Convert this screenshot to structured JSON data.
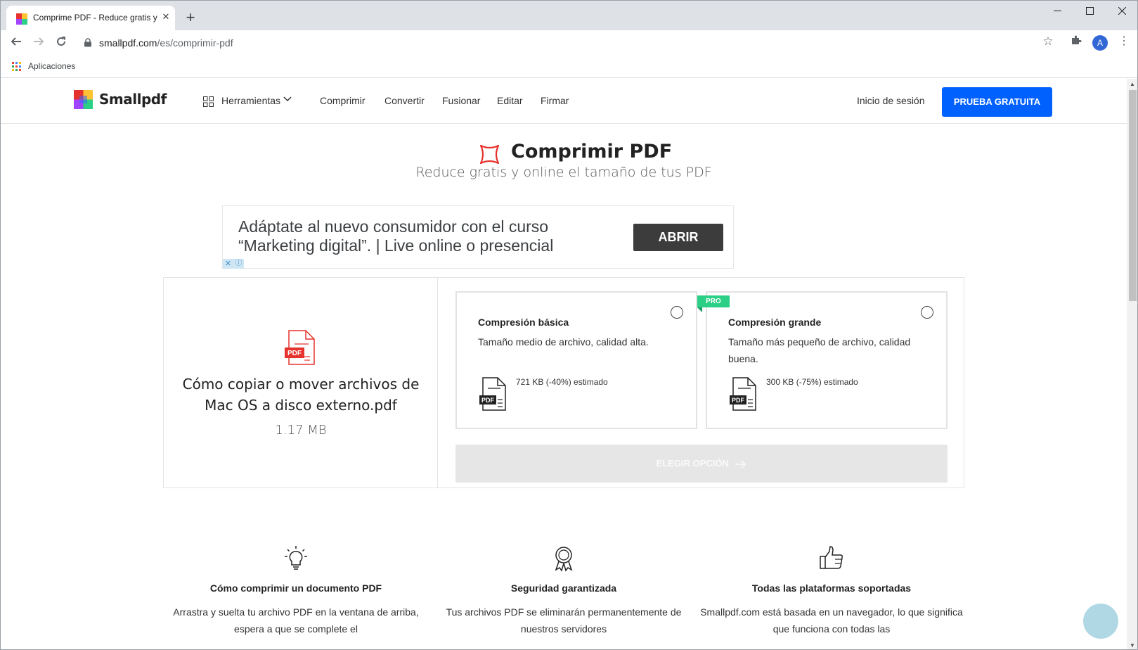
{
  "browser": {
    "tab_title": "Comprime PDF - Reduce gratis y",
    "tab_close": "✕",
    "new_tab": "+",
    "url_host": "smallpdf.com",
    "url_path": "/es/comprimir-pdf",
    "avatar_initial": "A",
    "bookmarks": [
      {
        "label": "Aplicaciones"
      }
    ]
  },
  "site": {
    "brand": "Smallpdf",
    "nav": {
      "tools_label": "Herramientas",
      "links": [
        "Comprimir",
        "Convertir",
        "Fusionar",
        "Editar",
        "Firmar"
      ],
      "login": "Inicio de sesión",
      "cta": "PRUEBA GRATUITA"
    },
    "title": "Comprimir PDF",
    "subtitle": "Reduce gratis y online el tamaño de tus PDF"
  },
  "ad": {
    "text": "Adáptate al nuevo consumidor con el curso “Marketing digital”. | Live online o presencial",
    "button": "ABRIR"
  },
  "file": {
    "badge": "PDF",
    "name": "Cómo copiar o mover archivos de Mac OS a disco externo.pdf",
    "size": "1.17 MB"
  },
  "options": [
    {
      "title": "Compresión básica",
      "description": "Tamaño medio de archivo, calidad alta.",
      "estimate": "721 KB (-40%) estimado",
      "selected": false
    },
    {
      "title": "Compresión grande",
      "description": "Tamaño más pequeño de archivo, calidad buena.",
      "estimate": "300 KB (-75%) estimado",
      "badge": "PRO",
      "selected": false
    }
  ],
  "choose_button": "ELEGIR OPCIÓN",
  "features": [
    {
      "icon": "lightbulb-icon",
      "title": "Cómo comprimir un documento PDF",
      "text": "Arrastra y suelta tu archivo PDF en la ventana de arriba, espera a que se complete el"
    },
    {
      "icon": "award-icon",
      "title": "Seguridad garantizada",
      "text": "Tus archivos PDF se eliminarán permanentemente de nuestros servidores"
    },
    {
      "icon": "thumbs-up-icon",
      "title": "Todas las plataformas soportadas",
      "text": "Smallpdf.com está basada en un navegador, lo que significa que funciona con todas las"
    }
  ],
  "colors": {
    "accent": "#0061fe",
    "pdf_red": "#e5322d",
    "pro_green": "#2bcf85"
  }
}
